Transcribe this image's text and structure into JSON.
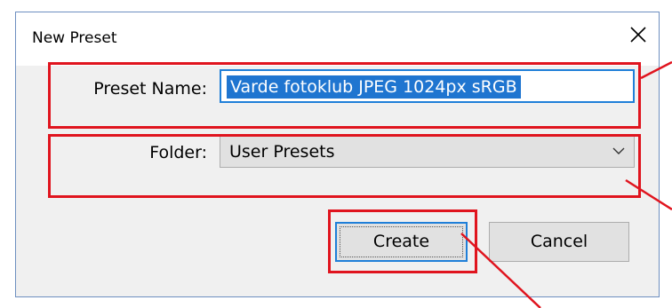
{
  "dialog": {
    "title": "New Preset",
    "close_glyph": "✕"
  },
  "preset_name": {
    "label": "Preset Name:",
    "value": "Varde fotoklub JPEG 1024px sRGB"
  },
  "folder": {
    "label": "Folder:",
    "value": "User Presets"
  },
  "buttons": {
    "create_label": "Create",
    "cancel_label": "Cancel"
  },
  "colors": {
    "annotation_red": "#e0141e",
    "focus_blue": "#1f7fd8",
    "selection_blue": "#1f75d0",
    "dialog_bg": "#f0f0f0"
  },
  "icons": {
    "close": "close-icon",
    "dropdown": "chevron-down-icon"
  }
}
